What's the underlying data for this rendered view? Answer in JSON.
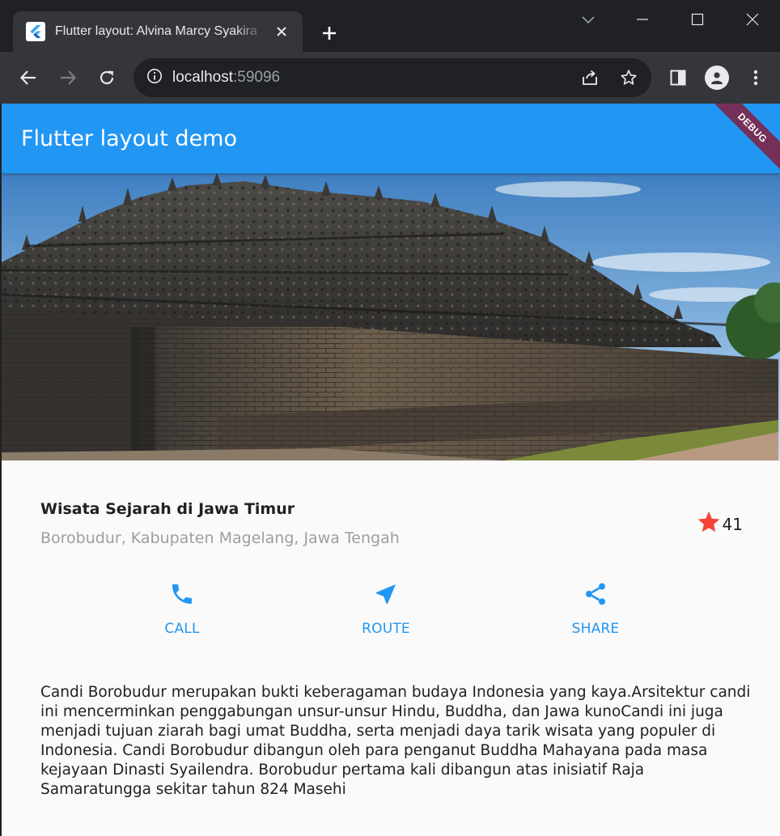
{
  "browser": {
    "tab_title": "Flutter layout: Alvina Marcy Syakira",
    "url_host": "localhost",
    "url_port": ":59096"
  },
  "app": {
    "appbar_title": "Flutter layout demo",
    "debug_banner": "DEBUG"
  },
  "title_section": {
    "title": "Wisata Sejarah di Jawa Timur",
    "subtitle": "Borobudur, Kabupaten Magelang, Jawa Tengah",
    "rating_count": "41"
  },
  "buttons": [
    {
      "label": "CALL",
      "icon": "phone-icon"
    },
    {
      "label": "ROUTE",
      "icon": "near-me-icon"
    },
    {
      "label": "SHARE",
      "icon": "share-icon"
    }
  ],
  "description": "Candi Borobudur merupakan bukti keberagaman budaya Indonesia yang kaya.Arsitektur candi ini mencerminkan penggabungan unsur-unsur Hindu, Buddha, dan Jawa kunoCandi ini juga menjadi tujuan ziarah bagi umat Buddha, serta menjadi daya tarik wisata yang populer di Indonesia. Candi Borobudur dibangun oleh para penganut Buddha Mahayana pada masa kejayaan Dinasti Syailendra. Borobudur pertama kali dibangun atas inisiatif Raja Samaratungga sekitar tahun 824 Masehi",
  "colors": {
    "primary": "#2196f3",
    "star": "#f44336",
    "subtitle": "#9e9e9e"
  }
}
